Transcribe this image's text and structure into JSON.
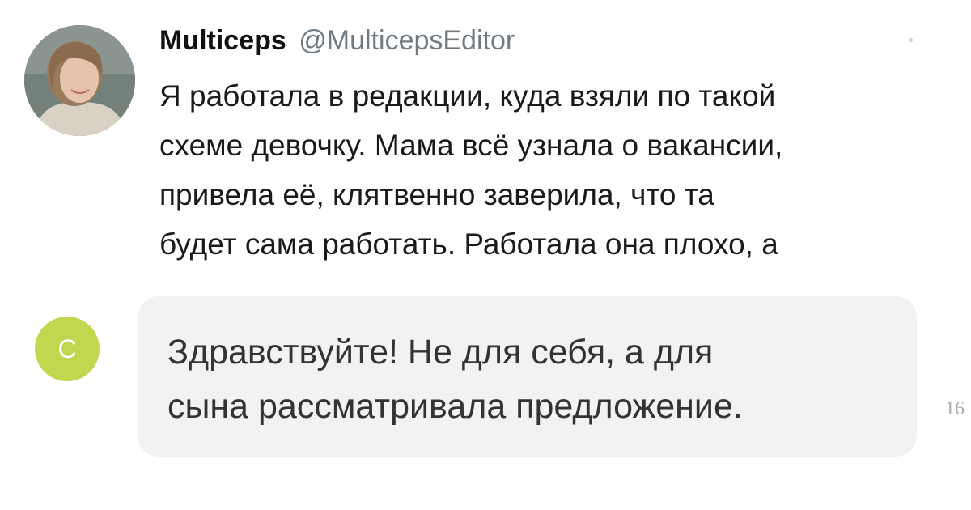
{
  "tweet": {
    "author_name": "Multiceps",
    "author_handle": "@MulticepsEditor",
    "lines": [
      "Я работала в редакции, куда взяли по такой",
      "схеме девочку. Мама всё узнала о вакансии,",
      "привела её, клятвенно заверила, что та",
      "будет сама работать. Работала она плохо, а"
    ]
  },
  "reply": {
    "initial": "С",
    "avatar_color": "#c2d650",
    "lines": [
      "Здравствуйте! Не для себя, а для",
      "сына рассматривала предложение."
    ],
    "time_partial": "16"
  }
}
